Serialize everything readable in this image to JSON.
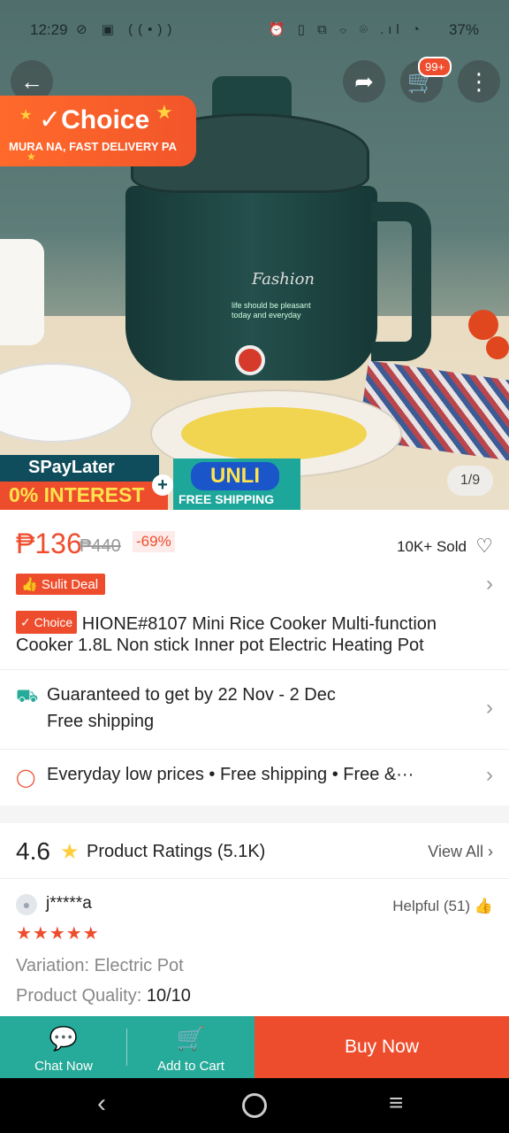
{
  "status_bar": {
    "time": "12:29",
    "left_icons": "⊘ ▣ ((•))",
    "right_icons": "⏰ ▯ ⧉ ⌔ ⌾ .ıl ◔",
    "battery": "37%"
  },
  "hero": {
    "cart_badge": "99+",
    "choice_title": "✓Choice",
    "choice_subtitle": "MURA NA, FAST DELIVERY PA",
    "product_brand_text": "Fashion",
    "product_small_text": "life should be pleasant today and everyday",
    "spay_title": "SPayLater",
    "spay_interest": "0% INTEREST",
    "unli_title": "UNLI",
    "unli_subtitle": "FREE SHIPPING",
    "image_counter": "1/9"
  },
  "price": {
    "current": "₱136",
    "original": "₱440",
    "discount": "-69%",
    "sold": "10K+ Sold"
  },
  "deal": {
    "label": "Sulit Deal"
  },
  "product": {
    "choice_tag": "✓ Choice",
    "title": "HIONE#8107 Mini Rice Cooker Multi-function Cooker 1.8L Non stick Inner pot Electric Heating Pot"
  },
  "shipping": {
    "line1": "Guaranteed to get by 22 Nov - 2 Dec",
    "line2": "Free shipping"
  },
  "guarantees": {
    "text": "Everyday low prices  •  Free shipping  •  Free &···"
  },
  "ratings": {
    "score": "4.6",
    "label": "Product Ratings (5.1K)",
    "view_all": "View All"
  },
  "review": {
    "user": "j*****a",
    "helpful": "Helpful (51)",
    "stars": "★★★★★",
    "variation": "Variation: Electric Pot",
    "quality_label": "Product Quality: ",
    "quality_value": "10/10"
  },
  "actions": {
    "chat": "Chat Now",
    "add_to_cart": "Add to Cart",
    "buy_now": "Buy Now"
  },
  "colors": {
    "brand": "#ee4d2d",
    "teal": "#26aa99"
  }
}
